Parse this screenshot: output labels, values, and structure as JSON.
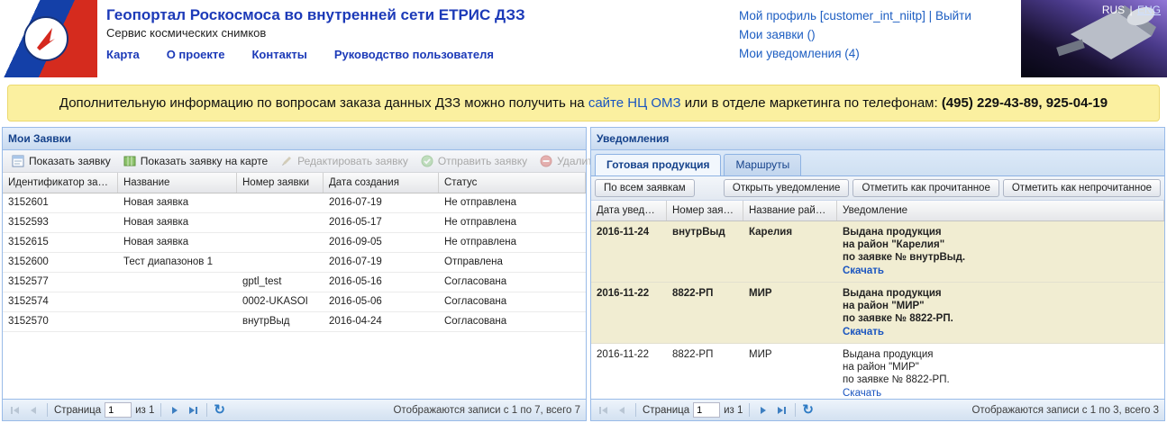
{
  "header": {
    "title": "Геопортал Роскосмоса во внутренней сети ЕТРИС ДЗЗ",
    "subtitle": "Сервис космических снимков",
    "nav": [
      "Карта",
      "О проекте",
      "Контакты",
      "Руководство пользователя"
    ],
    "account": {
      "profile": "Мой профиль [customer_int_niitp]",
      "sep": "|",
      "logout": "Выйти",
      "requests": "Мои заявки ()",
      "notifications": "Мои уведомления (4)"
    },
    "lang": {
      "rus": "RUS",
      "sep": "|",
      "eng": "ENG"
    }
  },
  "banner": {
    "before": "Дополнительную информацию по вопросам заказа данных ДЗЗ можно получить на ",
    "link": "сайте НЦ ОМЗ",
    "middle": " или в отделе маркетинга по телефонам: ",
    "phones": "(495) 229-43-89, 925-04-19"
  },
  "requests_panel": {
    "title": "Мои Заявки",
    "toolbar": [
      {
        "label": "Показать заявку",
        "enabled": true
      },
      {
        "label": "Показать заявку на карте",
        "enabled": true
      },
      {
        "label": "Редактировать заявку",
        "enabled": false
      },
      {
        "label": "Отправить заявку",
        "enabled": false
      },
      {
        "label": "Удалить заявку",
        "enabled": false
      }
    ],
    "columns": [
      "Идентификатор заявки",
      "Название",
      "Номер заявки",
      "Дата создания",
      "Статус"
    ],
    "rows": [
      [
        "3152601",
        "Новая заявка",
        "",
        "2016-07-19",
        "Не отправлена"
      ],
      [
        "3152593",
        "Новая заявка",
        "",
        "2016-05-17",
        "Не отправлена"
      ],
      [
        "3152615",
        "Новая заявка",
        "",
        "2016-09-05",
        "Не отправлена"
      ],
      [
        "3152600",
        "Тест диапазонов 1",
        "",
        "2016-07-19",
        "Отправлена"
      ],
      [
        "3152577",
        "",
        "gptl_test",
        "2016-05-16",
        "Согласована"
      ],
      [
        "3152574",
        "",
        "0002-UKASOI",
        "2016-05-06",
        "Согласована"
      ],
      [
        "3152570",
        "",
        "внутрВыд",
        "2016-04-24",
        "Согласована"
      ]
    ],
    "pager": {
      "page_label": "Страница",
      "page_value": "1",
      "of_label": "из 1",
      "status": "Отображаются записи с 1 по 7, всего 7"
    }
  },
  "notifications_panel": {
    "title": "Уведомления",
    "tabs": [
      {
        "label": "Готовая продукция",
        "active": true
      },
      {
        "label": "Маршруты",
        "active": false
      }
    ],
    "filter_button": "По всем заявкам",
    "actions": [
      "Открыть уведомление",
      "Отметить как прочитанное",
      "Отметить как непрочитанное"
    ],
    "columns": [
      "Дата уведомл...",
      "Номер заявки",
      "Название района",
      "Уведомление"
    ],
    "rows": [
      {
        "date": "2016-11-24",
        "request": "внутрВыд",
        "region": "Карелия",
        "lines": [
          "Выдана продукция",
          "на район \"Карелия\"",
          "по заявке № внутрВыд."
        ],
        "link": "Скачать",
        "unread": true
      },
      {
        "date": "2016-11-22",
        "request": "8822-РП",
        "region": "МИР",
        "lines": [
          "Выдана продукция",
          "на район \"МИР\"",
          "по заявке № 8822-РП."
        ],
        "link": "Скачать",
        "unread": true
      },
      {
        "date": "2016-11-22",
        "request": "8822-РП",
        "region": "МИР",
        "lines": [
          "Выдана продукция",
          "на район \"МИР\"",
          "по заявке № 8822-РП."
        ],
        "link": "Скачать",
        "unread": false
      }
    ],
    "pager": {
      "page_label": "Страница",
      "page_value": "1",
      "of_label": "из 1",
      "status": "Отображаются записи с 1 по 3, всего 3"
    }
  }
}
